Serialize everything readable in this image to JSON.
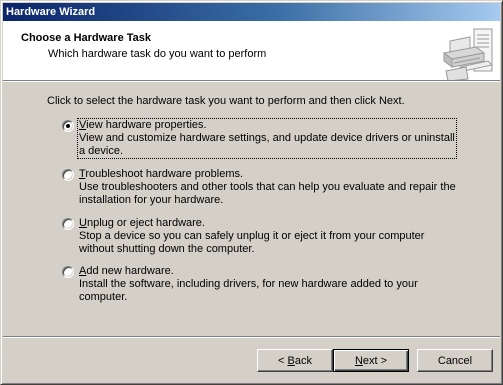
{
  "window": {
    "title": "Hardware Wizard"
  },
  "header": {
    "title": "Choose a Hardware Task",
    "subtitle": "Which hardware task do you want to perform",
    "icon": "hardware-printer-icon"
  },
  "instruction": "Click to select the hardware task you want to perform and then click Next.",
  "options": [
    {
      "key": "V",
      "rest": "iew hardware properties.",
      "description": "View and customize hardware settings, and update device drivers or uninstall a device.",
      "selected": true
    },
    {
      "key": "T",
      "rest": "roubleshoot hardware problems.",
      "description": "Use troubleshooters and other tools that can help you evaluate and repair the installation for your hardware.",
      "selected": false
    },
    {
      "key": "U",
      "rest": "nplug or eject hardware.",
      "description": "Stop a device so you can safely unplug it or eject it from your computer without shutting down the computer.",
      "selected": false
    },
    {
      "key": "A",
      "rest": "dd new hardware.",
      "description": "Install the software, including drivers, for new hardware added to your computer.",
      "selected": false
    }
  ],
  "buttons": {
    "back": {
      "prefix": "< ",
      "key": "B",
      "rest": "ack"
    },
    "next": {
      "key": "N",
      "rest": "ext >"
    },
    "cancel": {
      "label": "Cancel"
    }
  },
  "colors": {
    "face": "#d4d0c8",
    "title_start": "#0a246a",
    "title_end": "#a6caf0",
    "header_bg": "#ffffff"
  }
}
